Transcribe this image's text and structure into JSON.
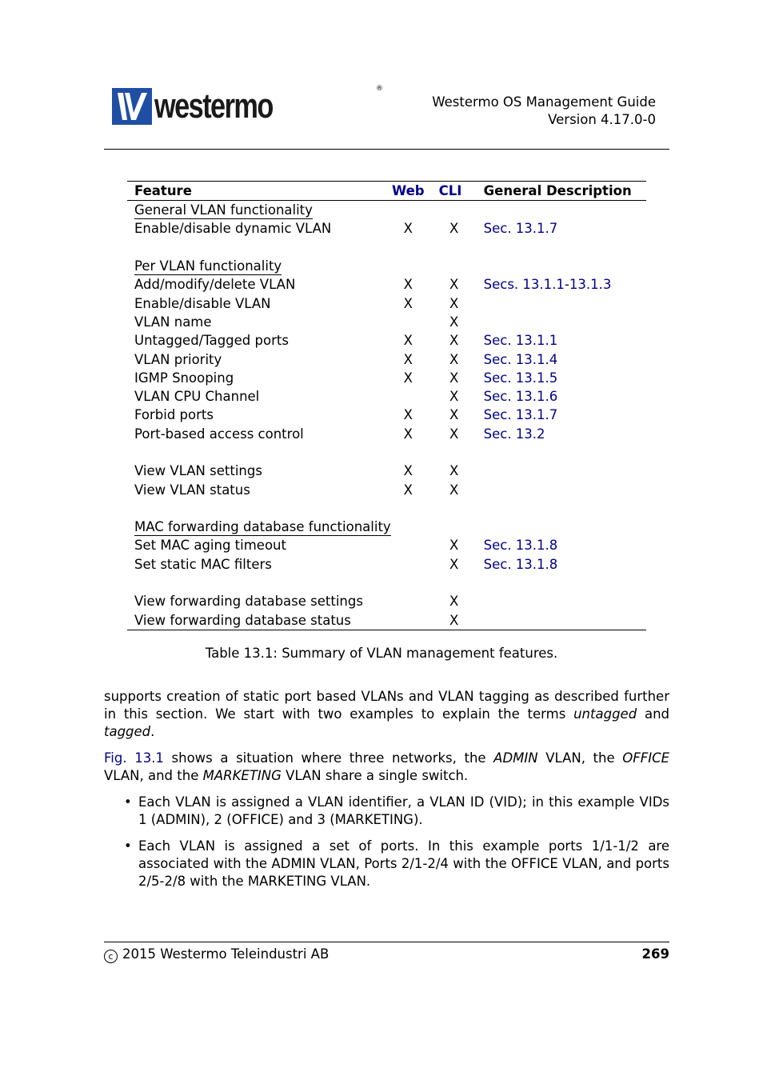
{
  "header": {
    "logo_text": "westermo",
    "logo_reg": "®",
    "guide_title": "Westermo OS Management Guide",
    "version": "Version 4.17.0-0"
  },
  "table": {
    "columns": {
      "feature": "Feature",
      "web": "Web",
      "cli": "CLI",
      "description": "General Description"
    },
    "rows": [
      {
        "type": "section",
        "feature": "General VLAN functionality"
      },
      {
        "type": "item",
        "feature": "Enable/disable dynamic VLAN",
        "web": "X",
        "cli": "X",
        "description": "Sec. 13.1.7"
      },
      {
        "type": "blank"
      },
      {
        "type": "section",
        "feature": "Per VLAN functionality"
      },
      {
        "type": "item",
        "feature": "Add/modify/delete VLAN",
        "web": "X",
        "cli": "X",
        "description": "Secs. 13.1.1-13.1.3"
      },
      {
        "type": "item",
        "feature": "Enable/disable VLAN",
        "web": "X",
        "cli": "X",
        "description": ""
      },
      {
        "type": "item",
        "feature": "VLAN name",
        "web": "",
        "cli": "X",
        "description": ""
      },
      {
        "type": "item",
        "feature": "Untagged/Tagged ports",
        "web": "X",
        "cli": "X",
        "description": "Sec. 13.1.1"
      },
      {
        "type": "item",
        "feature": "VLAN priority",
        "web": "X",
        "cli": "X",
        "description": "Sec. 13.1.4"
      },
      {
        "type": "item",
        "feature": "IGMP Snooping",
        "web": "X",
        "cli": "X",
        "description": "Sec. 13.1.5"
      },
      {
        "type": "item",
        "feature": "VLAN CPU Channel",
        "web": "",
        "cli": "X",
        "description": "Sec. 13.1.6"
      },
      {
        "type": "item",
        "feature": "Forbid ports",
        "web": "X",
        "cli": "X",
        "description": "Sec. 13.1.7"
      },
      {
        "type": "item",
        "feature": "Port-based access control",
        "web": "X",
        "cli": "X",
        "description": "Sec. 13.2"
      },
      {
        "type": "blank"
      },
      {
        "type": "item",
        "feature": "View VLAN settings",
        "web": "X",
        "cli": "X",
        "description": ""
      },
      {
        "type": "item",
        "feature": "View VLAN status",
        "web": "X",
        "cli": "X",
        "description": ""
      },
      {
        "type": "blank"
      },
      {
        "type": "section",
        "feature": "MAC forwarding database functionality"
      },
      {
        "type": "item",
        "feature": "Set MAC aging timeout",
        "web": "",
        "cli": "X",
        "description": "Sec. 13.1.8"
      },
      {
        "type": "item",
        "feature": "Set static MAC filters",
        "web": "",
        "cli": "X",
        "description": "Sec. 13.1.8"
      },
      {
        "type": "blank"
      },
      {
        "type": "item",
        "feature": "View forwarding database settings",
        "web": "",
        "cli": "X",
        "description": ""
      },
      {
        "type": "item",
        "feature": "View forwarding database status",
        "web": "",
        "cli": "X",
        "description": ""
      }
    ],
    "caption": "Table 13.1: Summary of VLAN management features."
  },
  "body": {
    "p1": {
      "a": "supports creation of static port based VLANs and VLAN tagging as described further in this section.  We start with two examples to explain the terms ",
      "b": "untagged",
      "c": " and ",
      "d": "tagged",
      "e": "."
    },
    "p2": {
      "link": "Fig. 13.1",
      "a": " shows a situation where three networks, the ",
      "b": "ADMIN",
      "c": " VLAN, the ",
      "d": "OFFICE",
      "e": " VLAN, and the ",
      "f": "MARKETING",
      "g": " VLAN share a single switch."
    },
    "bullets": [
      "Each VLAN is assigned a VLAN identifier, a VLAN ID (VID); in this example VIDs 1 (ADMIN), 2 (OFFICE) and 3 (MARKETING).",
      "Each VLAN is assigned a set of ports.  In this example ports 1/1-1/2 are associated with the ADMIN VLAN, Ports 2/1-2/4 with the OFFICE VLAN, and ports 2/5-2/8 with the MARKETING VLAN."
    ]
  },
  "footer": {
    "copyright_symbol": "c",
    "copyright_text": "2015 Westermo Teleindustri AB",
    "page_number": "269"
  }
}
